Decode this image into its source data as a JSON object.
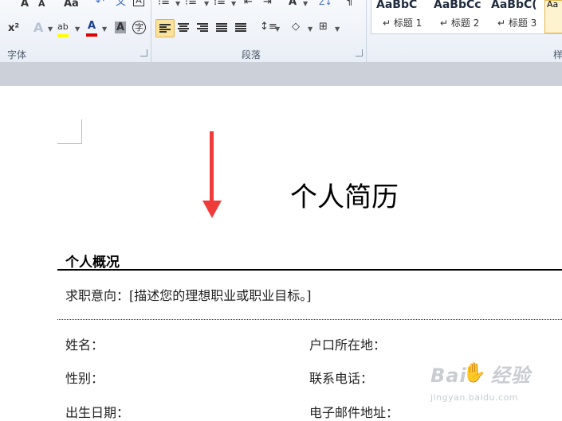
{
  "ribbon": {
    "font_group_label": "字体",
    "paragraph_group_label": "段落",
    "styles_group_label_partial": "样",
    "font_buttons": {
      "grow_font": "A",
      "shrink_font": "A",
      "change_case": "Aa",
      "superscript": "x²",
      "text_effects": "A",
      "font_color": "A",
      "char_shading": "A",
      "enclose_char": "字"
    },
    "styles": [
      {
        "preview": "AaBbC",
        "name": "↵ 标题 1"
      },
      {
        "preview": "AaBbCc",
        "name": "↵ 标题 2"
      },
      {
        "preview": "AaBbC(",
        "name": "↵ 标题 3"
      }
    ],
    "selected_style_preview": "Aa",
    "colors": {
      "highlight": "#ffff00",
      "font_color": "#e00000",
      "active": "#fbe29a"
    }
  },
  "document": {
    "title": "个人简历",
    "section_heading": "个人概况",
    "objective": "求职意向：[描述您的理想职业或职业目标。]",
    "fields_left": [
      "姓名：",
      "性别：",
      "出生日期："
    ],
    "fields_right": [
      "户口所在地：",
      "联系电话：",
      "电子邮件地址："
    ]
  },
  "watermark": {
    "brand": "Bai",
    "brand2": "经验",
    "url": "jingyan.baidu.com"
  }
}
